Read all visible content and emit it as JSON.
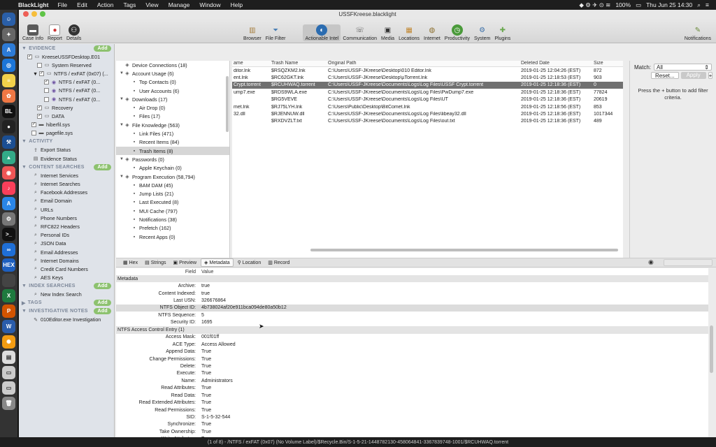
{
  "menubar": {
    "app_name": "BlackLight",
    "items": [
      "File",
      "Edit",
      "Action",
      "Tags",
      "View",
      "Manage",
      "Window",
      "Help"
    ],
    "battery": "100%",
    "clock": "Thu Jun 25  14:30"
  },
  "window": {
    "title": "USSFKreese.blacklight"
  },
  "toolbar": {
    "left": [
      {
        "label": "Case Info",
        "icon": "briefcase-icon"
      },
      {
        "label": "Report",
        "icon": "report-icon"
      },
      {
        "label": "Details",
        "icon": "details-icon"
      }
    ],
    "center": [
      {
        "label": "Browser",
        "icon": "browser-icon"
      },
      {
        "label": "File Filter",
        "icon": "funnel-icon"
      },
      {
        "label": "Actionable Intel",
        "icon": "globe-icon"
      },
      {
        "label": "Communication",
        "icon": "communication-icon"
      },
      {
        "label": "Media",
        "icon": "media-icon"
      },
      {
        "label": "Locations",
        "icon": "map-icon"
      },
      {
        "label": "Internet",
        "icon": "internet-icon"
      },
      {
        "label": "Productivity",
        "icon": "clock-icon"
      },
      {
        "label": "System",
        "icon": "system-icon"
      },
      {
        "label": "Plugins",
        "icon": "puzzle-icon"
      }
    ],
    "right": {
      "label": "Notifications",
      "icon": "notifications-icon"
    }
  },
  "sidebar": {
    "evidence_header": "EVIDENCE",
    "evidence_items": [
      {
        "label": "KreeseUSSFDesktop.E01",
        "indent": 1
      },
      {
        "label": "System Reserved",
        "indent": 2
      },
      {
        "label": "NTFS / exFAT (0x07) (...",
        "indent": 2
      },
      {
        "label": "NTFS / exFAT (0...",
        "indent": 3
      },
      {
        "label": "NTFS / exFAT (0...",
        "indent": 3
      },
      {
        "label": "NTFS / exFAT (0...",
        "indent": 3
      },
      {
        "label": "Recovery",
        "indent": 2
      },
      {
        "label": "DATA",
        "indent": 2
      },
      {
        "label": "hiberfil.sys",
        "indent": 1
      },
      {
        "label": "pagefile.sys",
        "indent": 1
      }
    ],
    "activity_header": "ACTIVITY",
    "activity_items": [
      "Export Status",
      "Evidence Status"
    ],
    "content_header": "CONTENT SEARCHES",
    "content_items": [
      "Internet Services",
      "Internet Searches",
      "Facebook Addresses",
      "Email Domain",
      "URLs",
      "Phone Numbers",
      "RFC822 Headers",
      "Personal IDs",
      "JSON Data",
      "Email Addresses",
      "Internet Domains",
      "Credit Card Numbers",
      "AES Keys"
    ],
    "index_header": "INDEX SEARCHES",
    "index_items": [
      "New Index Search"
    ],
    "tags_header": "TAGS",
    "notes_header": "INVESTIGATIVE NOTES",
    "notes_items": [
      "010Editor.exe Investigation"
    ],
    "add_label": "Add"
  },
  "tree": [
    {
      "label": "Device Connections (18)",
      "level": 0,
      "tri": ""
    },
    {
      "label": "Account Usage (6)",
      "level": 0,
      "tri": "▼"
    },
    {
      "label": "Top Contacts (0)",
      "level": 1,
      "tri": ""
    },
    {
      "label": "User Accounts (6)",
      "level": 1,
      "tri": ""
    },
    {
      "label": "Downloads (17)",
      "level": 0,
      "tri": "▼"
    },
    {
      "label": "Air Drop (0)",
      "level": 1,
      "tri": ""
    },
    {
      "label": "Files (17)",
      "level": 1,
      "tri": ""
    },
    {
      "label": "File Knowledge (563)",
      "level": 0,
      "tri": "▼"
    },
    {
      "label": "Link Files (471)",
      "level": 1,
      "tri": ""
    },
    {
      "label": "Recent Items (84)",
      "level": 1,
      "tri": ""
    },
    {
      "label": "Trash Items (8)",
      "level": 1,
      "tri": "",
      "selected": true
    },
    {
      "label": "Passwords (0)",
      "level": 0,
      "tri": "▼"
    },
    {
      "label": "Apple Keychain (0)",
      "level": 1,
      "tri": ""
    },
    {
      "label": "Program Execution (58,794)",
      "level": 0,
      "tri": "▼"
    },
    {
      "label": "BAM DAM (45)",
      "level": 1,
      "tri": ""
    },
    {
      "label": "Jump Lists (21)",
      "level": 1,
      "tri": ""
    },
    {
      "label": "Last Executed (8)",
      "level": 1,
      "tri": ""
    },
    {
      "label": "MUI Cache (797)",
      "level": 1,
      "tri": ""
    },
    {
      "label": "Notifications (38)",
      "level": 1,
      "tri": ""
    },
    {
      "label": "Prefetch (162)",
      "level": 1,
      "tri": ""
    },
    {
      "label": "Recent Apps (0)",
      "level": 1,
      "tri": ""
    }
  ],
  "files": {
    "headers": [
      "ame",
      "Trash Name",
      "Original Path",
      "Deleted Date",
      "Size"
    ],
    "rows": [
      [
        "ditor.lnk",
        "$RSQZKM2.lnk",
        "C:\\Users\\USSF-JKreese\\Desktop\\010 Editor.lnk",
        "2019-01-25 12:04:26 (EST)",
        "872"
      ],
      [
        "ent.lnk",
        "$RC62GKT.lnk",
        "C:\\Users\\USSF-JKreese\\Desktop\\µTorrent.lnk",
        "2019-01-25 12:18:53 (EST)",
        "903"
      ],
      [
        "Crypt.torrent",
        "$RCUHWAQ.torrent",
        "C:\\Users\\USSF-JKreese\\Documents\\Logs\\Log Files\\USSF Crypt.torrent",
        "2019-01-25 12:18:36 (EST)",
        "0"
      ],
      [
        "ump7.exe",
        "$RDS9WLA.exe",
        "C:\\Users\\USSF-JKreese\\Documents\\Logs\\Log Files\\PwDump7.exe",
        "2019-01-25 12:18:36 (EST)",
        "77824"
      ],
      [
        "",
        "$RG5VEVE",
        "C:\\Users\\USSF-JKreese\\Documents\\Logs\\Log Files\\UT",
        "2019-01-25 12:18:36 (EST)",
        "20619"
      ],
      [
        "met.lnk",
        "$RJ75LYH.lnk",
        "C:\\Users\\Public\\Desktop\\BitComet.lnk",
        "2019-01-25 12:18:56 (EST)",
        "853"
      ],
      [
        "32.dll",
        "$RJENNUW.dll",
        "C:\\Users\\USSF-JKreese\\Documents\\Logs\\Log Files\\libeay32.dll",
        "2019-01-25 12:18:36 (EST)",
        "1017344"
      ],
      [
        "",
        "$RXDVZLT.txt",
        "C:\\Users\\USSF-JKreese\\Documents\\Logs\\Log Files\\out.txt",
        "2019-01-25 12:18:36 (EST)",
        "489"
      ]
    ],
    "selected_index": 2
  },
  "filter": {
    "match_label": "Match:",
    "match_value": "All",
    "reset_label": "Reset...",
    "apply_label": "Apply",
    "plus_label": "+",
    "hint": "Press the + button to add filter criteria."
  },
  "tabs": [
    {
      "label": "Hex",
      "icon": "hex-icon"
    },
    {
      "label": "Strings",
      "icon": "strings-icon"
    },
    {
      "label": "Preview",
      "icon": "preview-icon"
    },
    {
      "label": "Metadata",
      "icon": "metadata-icon",
      "active": true
    },
    {
      "label": "Location",
      "icon": "location-pin-icon"
    },
    {
      "label": "Record",
      "icon": "record-icon"
    }
  ],
  "metadata": {
    "header_field": "Field",
    "header_value": "Value",
    "rows": [
      {
        "group": "Metadata"
      },
      {
        "k": "Archive:",
        "v": "true"
      },
      {
        "k": "Content Indexed:",
        "v": "true"
      },
      {
        "k": "Last USN:",
        "v": "326676864"
      },
      {
        "k": "NTFS Object ID:",
        "v": "4b738024af20e911bca094de80a50b12",
        "hl": true
      },
      {
        "k": "NTFS Sequence:",
        "v": "5"
      },
      {
        "k": "Security ID:",
        "v": "1695"
      },
      {
        "group": "NTFS Access Control Entry (1)"
      },
      {
        "k": "Access Mask:",
        "v": "001f01ff"
      },
      {
        "k": "ACE Type:",
        "v": "Access Allowed"
      },
      {
        "k": "Append Data:",
        "v": "True"
      },
      {
        "k": "Change Permissions:",
        "v": "True"
      },
      {
        "k": "Delete:",
        "v": "True"
      },
      {
        "k": "Execute:",
        "v": "True"
      },
      {
        "k": "Name:",
        "v": "Administrators"
      },
      {
        "k": "Read Attributes:",
        "v": "True"
      },
      {
        "k": "Read Data:",
        "v": "True"
      },
      {
        "k": "Read Extended Attributes:",
        "v": "True"
      },
      {
        "k": "Read Permissions:",
        "v": "True"
      },
      {
        "k": "SID:",
        "v": "S-1-5-32-544"
      },
      {
        "k": "Synchronize:",
        "v": "True"
      },
      {
        "k": "Take Ownership:",
        "v": "True"
      },
      {
        "k": "Write Attributes:",
        "v": "True"
      }
    ]
  },
  "status": "(1 of 8) - /NTFS / exFAT (0x07) (No Volume Label)/$Recycle.Bin/S-1-5-21-1448782130-458064841-3367839748-1001/$RCUHWAQ.torrent",
  "colors": {
    "accent": "#707070",
    "add_badge": "#8dc26f",
    "sidebar": "#dfe3e9"
  }
}
